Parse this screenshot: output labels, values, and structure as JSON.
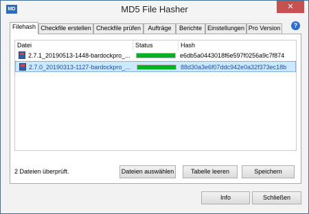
{
  "window": {
    "title": "MD5 File Hasher",
    "app_icon": "MD",
    "close_glyph": "✕"
  },
  "tabs": [
    {
      "label": "Filehash",
      "active": true
    },
    {
      "label": "Checkfile erstellen"
    },
    {
      "label": "Checkfile prüfen"
    },
    {
      "label": "Aufträge"
    },
    {
      "label": "Berichte"
    },
    {
      "label": "Einstellungen"
    },
    {
      "label": "Pro Version"
    }
  ],
  "help_glyph": "?",
  "table": {
    "columns": [
      "Datei",
      "Status",
      "Hash"
    ],
    "rows": [
      {
        "file": "2.7.1_20190513-1448-bardockpro_...",
        "progress": 1.0,
        "hash": "e6db5a0443018f6e597f0256a9c7f874",
        "selected": false
      },
      {
        "file": "2.7.0_20190313-1127-bardockpro_...",
        "progress": 1.0,
        "hash": "88d30a3e6f07ddc942e0a32f373ec18b",
        "selected": true
      }
    ]
  },
  "status": "2 Dateien überprüft.",
  "buttons": {
    "select_files": "Dateien auswählen",
    "clear_table": "Tabelle leeren",
    "save": "Speichern",
    "info": "Info",
    "close": "Schließen"
  },
  "colors": {
    "progress": "#06b025",
    "selection": "#cde8ff",
    "help": "#2e6fcc"
  }
}
